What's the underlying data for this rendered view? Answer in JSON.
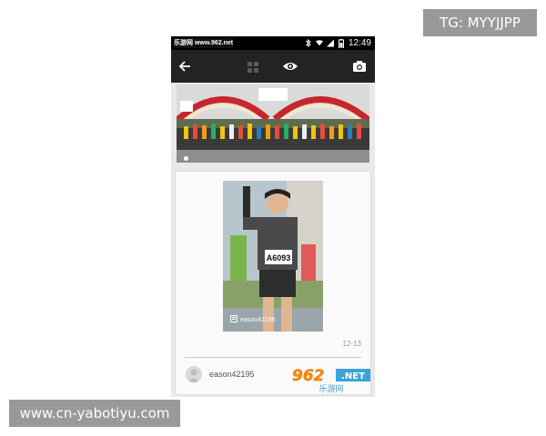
{
  "overlay": {
    "tg_label": "TG: MYYJJPP",
    "site_label": "www.cn-yabotiyu.com"
  },
  "statusbar": {
    "site": "乐游网 www.962.net",
    "time": "12:49",
    "icons": [
      "bluetooth-icon",
      "wifi-icon",
      "signal-icon",
      "battery-icon"
    ]
  },
  "toolbar": {
    "icons": [
      "back-arrow-icon",
      "grid-icon",
      "eye-icon",
      "camera-icon"
    ]
  },
  "hero": {
    "description_icon": "marathon-start-photo",
    "active_page": 1
  },
  "post": {
    "photo_tag": "eason42195",
    "bib_number": "A6093",
    "date": "12-13",
    "username": "eason42195"
  },
  "logo": {
    "brand": "962.NET",
    "subtitle": "乐游网"
  },
  "colors": {
    "toolbar": "#232323",
    "statusbar": "#000000",
    "background": "#e9e9e9",
    "logo_accent": "#ff8a00"
  }
}
